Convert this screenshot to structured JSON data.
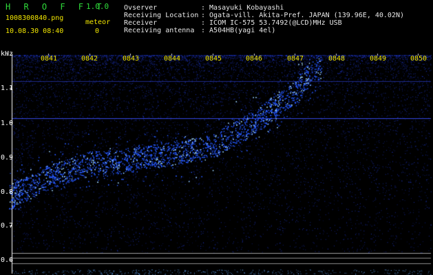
{
  "app": {
    "title": "H R O F F T",
    "version": "1.0.0",
    "file_name": "1008300840.png",
    "meteor_label": "meteor",
    "datetime": "10.08.30 08:40",
    "meteor_count": "0"
  },
  "info": {
    "rows": [
      {
        "label": "Ovserver",
        "value": ": Masayuki Kobayashi"
      },
      {
        "label": "Receiving Location",
        "value": ": Ogata-vill. Akita-Pref. JAPAN (139.96E, 40.02N)"
      },
      {
        "label": "Receiver",
        "value": ": ICOM IC-575 53.7492(@LCD)MHz USB"
      },
      {
        "label": "Receiving antenna",
        "value": ": A504HB(yagi 4el)"
      }
    ]
  },
  "plot": {
    "y_unit": "kHz",
    "y_ticks": [
      "1.1",
      "1.0",
      "0.9",
      "0.8",
      "0.7",
      "0.6"
    ],
    "x_ticks": [
      "0841",
      "0842",
      "0843",
      "0844",
      "0845",
      "0846",
      "0847",
      "0848",
      "0849",
      "0850"
    ],
    "colors": {
      "background": "#000000",
      "signal": "#2a4bff",
      "bright": "#9fd4ff",
      "axis": "#ffffff",
      "tick_text": "#f2e600"
    }
  },
  "chart_data": {
    "type": "scatter",
    "title": "",
    "xlabel": "",
    "ylabel": "kHz",
    "x_ticks": [
      "0841",
      "0842",
      "0843",
      "0844",
      "0845",
      "0846",
      "0847",
      "0848",
      "0849",
      "0850"
    ],
    "ylim": [
      0.58,
      1.2
    ],
    "series": [
      {
        "values": [
          {
            "x": "0840",
            "y": 0.78
          },
          {
            "x": "0841",
            "y": 0.84
          },
          {
            "x": "0842",
            "y": 0.88
          },
          {
            "x": "0843",
            "y": 0.89
          },
          {
            "x": "0844",
            "y": 0.91
          },
          {
            "x": "0845",
            "y": 0.93
          },
          {
            "x": "0846",
            "y": 1.0
          },
          {
            "x": "0847",
            "y": 1.09
          },
          {
            "x": "0847.5",
            "y": 1.16
          }
        ]
      }
    ]
  }
}
